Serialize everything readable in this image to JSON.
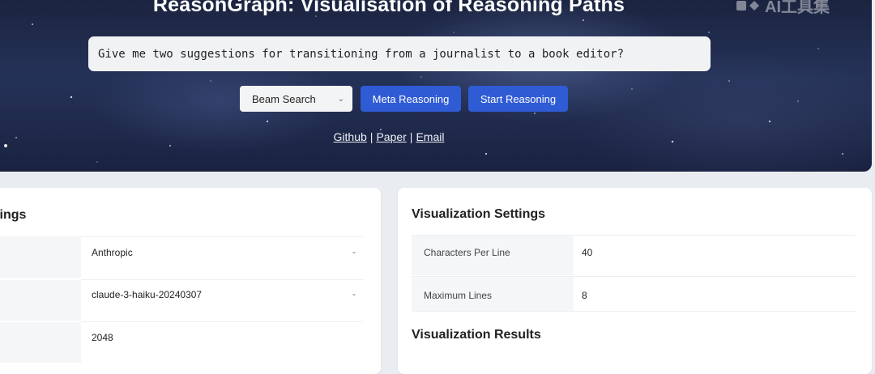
{
  "header": {
    "title": "ReasonGraph: Visualisation of Reasoning Paths",
    "watermark": "AI工具集"
  },
  "query": {
    "value": "Give me two suggestions for transitioning from a journalist to a book editor?"
  },
  "controls": {
    "method_select": {
      "value": "Beam Search"
    },
    "meta_button": "Meta Reasoning",
    "start_button": "Start Reasoning"
  },
  "links": [
    {
      "label": "Github"
    },
    {
      "label": "Paper"
    },
    {
      "label": "Email"
    }
  ],
  "link_separator": "|",
  "model_settings": {
    "title": "ettings",
    "rows": [
      {
        "value": "Anthropic"
      },
      {
        "value": "claude-3-haiku-20240307"
      },
      {
        "value": "2048"
      }
    ]
  },
  "visualization_settings": {
    "title": "Visualization Settings",
    "rows": [
      {
        "label": "Characters Per Line",
        "value": "40"
      },
      {
        "label": "Maximum Lines",
        "value": "8"
      }
    ]
  },
  "visualization_results": {
    "title": "Visualization Results"
  },
  "colors": {
    "accent": "#2f5bd4",
    "hero_bg": "#1f2a4a",
    "page_bg": "#e9ecf0"
  }
}
